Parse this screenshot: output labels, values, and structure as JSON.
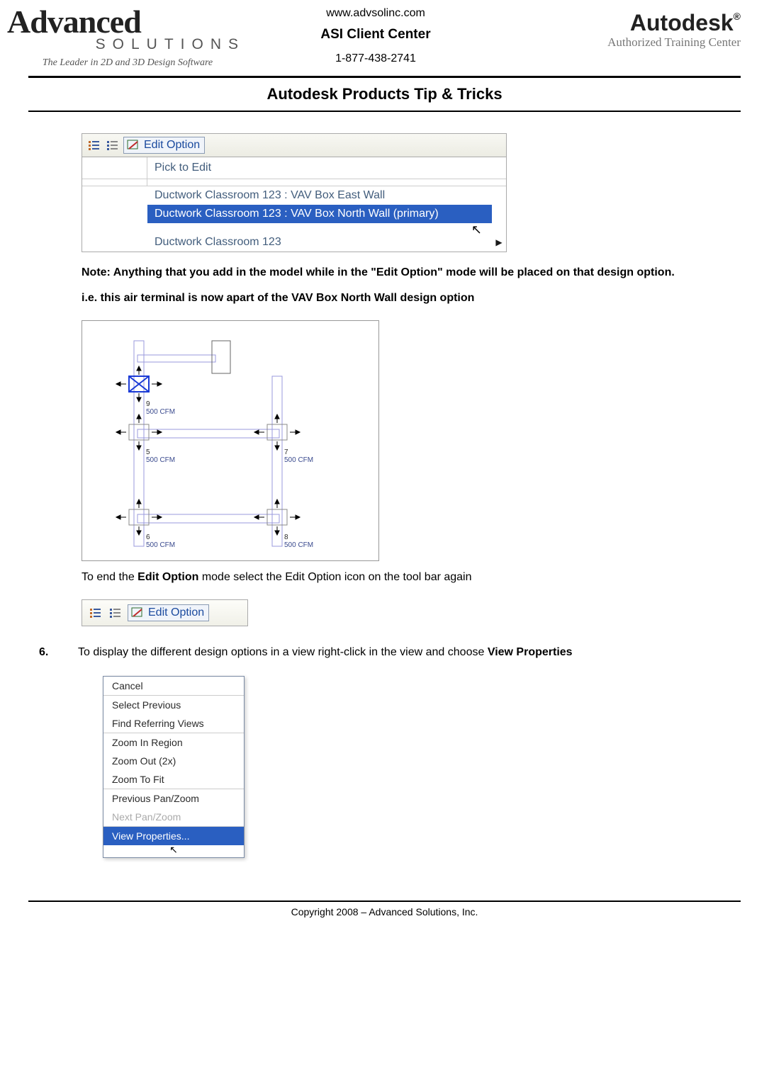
{
  "header": {
    "logo_left": {
      "line1": "Advanced",
      "line2": "SOLUTIONS",
      "tagline": "The Leader in 2D and 3D Design Software"
    },
    "center": {
      "url": "www.advsolinc.com",
      "client_center": "ASI Client Center",
      "phone": "1-877-438-2741"
    },
    "logo_right": {
      "brand": "Autodesk",
      "reg": "®",
      "sub": "Authorized Training Center"
    }
  },
  "page_title": "Autodesk Products Tip & Tricks",
  "edit_option_fig": {
    "button_label": "Edit Option",
    "combo_text": "Pick to Edit",
    "items": [
      "Ductwork Classroom 123 : VAV Box East Wall",
      "Ductwork Classroom 123 : VAV Box North Wall (primary)",
      "Ductwork Classroom 123"
    ],
    "selected_index": 1
  },
  "note_text_prefix": "Note:  Anything that you add in the model while in the \"Edit Option\" mode will be placed on that design option.",
  "ie_text": "i.e. this air terminal is now apart of the VAV Box North Wall design option",
  "duct_terminals": [
    {
      "num": "9",
      "cfm": "500 CFM"
    },
    {
      "num": "5",
      "cfm": "500 CFM"
    },
    {
      "num": "7",
      "cfm": "500 CFM"
    },
    {
      "num": "6",
      "cfm": "500 CFM"
    },
    {
      "num": "8",
      "cfm": "500 CFM"
    }
  ],
  "end_edit_text_1": "To end the ",
  "end_edit_text_bold": "Edit Option",
  "end_edit_text_2": " mode select the Edit Option icon on the tool bar again",
  "toolbar_small": {
    "button_label": "Edit Option"
  },
  "step6": {
    "num": "6.",
    "text_1": "To display the different design options in a view right-click in the view and choose ",
    "text_bold": "View Properties"
  },
  "context_menu": {
    "items": [
      {
        "label": "Cancel",
        "disabled": false
      },
      {
        "label": "Select Previous",
        "disabled": false
      },
      {
        "label": "Find Referring Views",
        "disabled": false
      },
      {
        "label": "Zoom In Region",
        "disabled": false
      },
      {
        "label": "Zoom Out (2x)",
        "disabled": false
      },
      {
        "label": "Zoom To Fit",
        "disabled": false
      },
      {
        "label": "Previous Pan/Zoom",
        "disabled": false
      },
      {
        "label": "Next Pan/Zoom",
        "disabled": true
      },
      {
        "label": "View Properties...",
        "disabled": false,
        "selected": true
      }
    ],
    "separators_after": [
      0,
      2,
      5,
      7
    ]
  },
  "footer": "Copyright 2008 – Advanced Solutions, Inc."
}
